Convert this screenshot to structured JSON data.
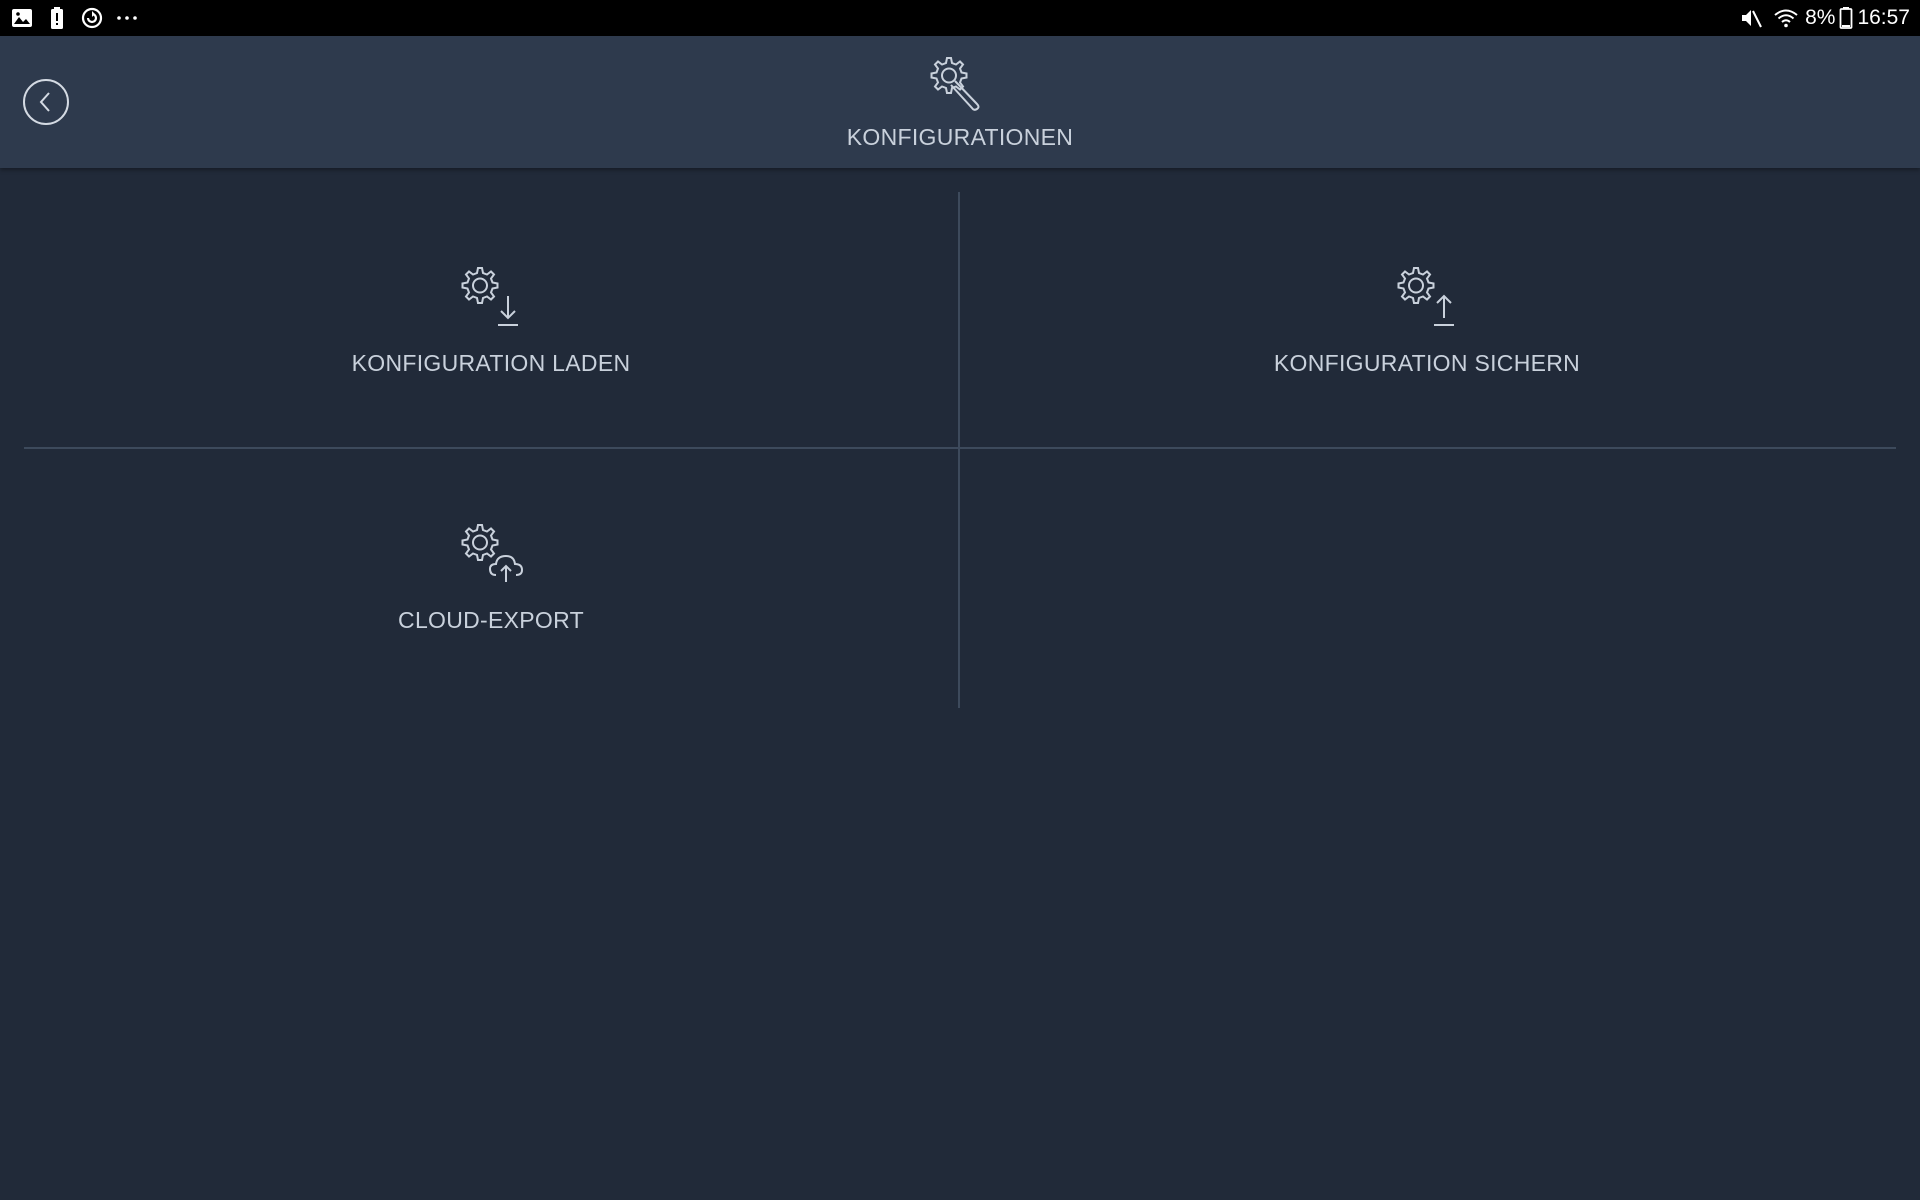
{
  "status_bar": {
    "left_icons": [
      "image-icon",
      "battery-alert-icon",
      "sync-icon",
      "more-icon"
    ],
    "battery_percent": "8%",
    "time": "16:57"
  },
  "header": {
    "title": "KONFIGURATIONEN",
    "icon": "gear-wrench-icon",
    "back_icon": "chevron-left-icon"
  },
  "tiles": [
    {
      "label": "KONFIGURATION LADEN",
      "icon": "gear-download-icon"
    },
    {
      "label": "KONFIGURATION SICHERN",
      "icon": "gear-upload-icon"
    },
    {
      "label": "CLOUD-EXPORT",
      "icon": "gear-cloud-upload-icon"
    }
  ],
  "colors": {
    "background": "#212a39",
    "header": "#2e3a4d",
    "text": "#c9d1dc",
    "divider": "#3d4a5c"
  }
}
